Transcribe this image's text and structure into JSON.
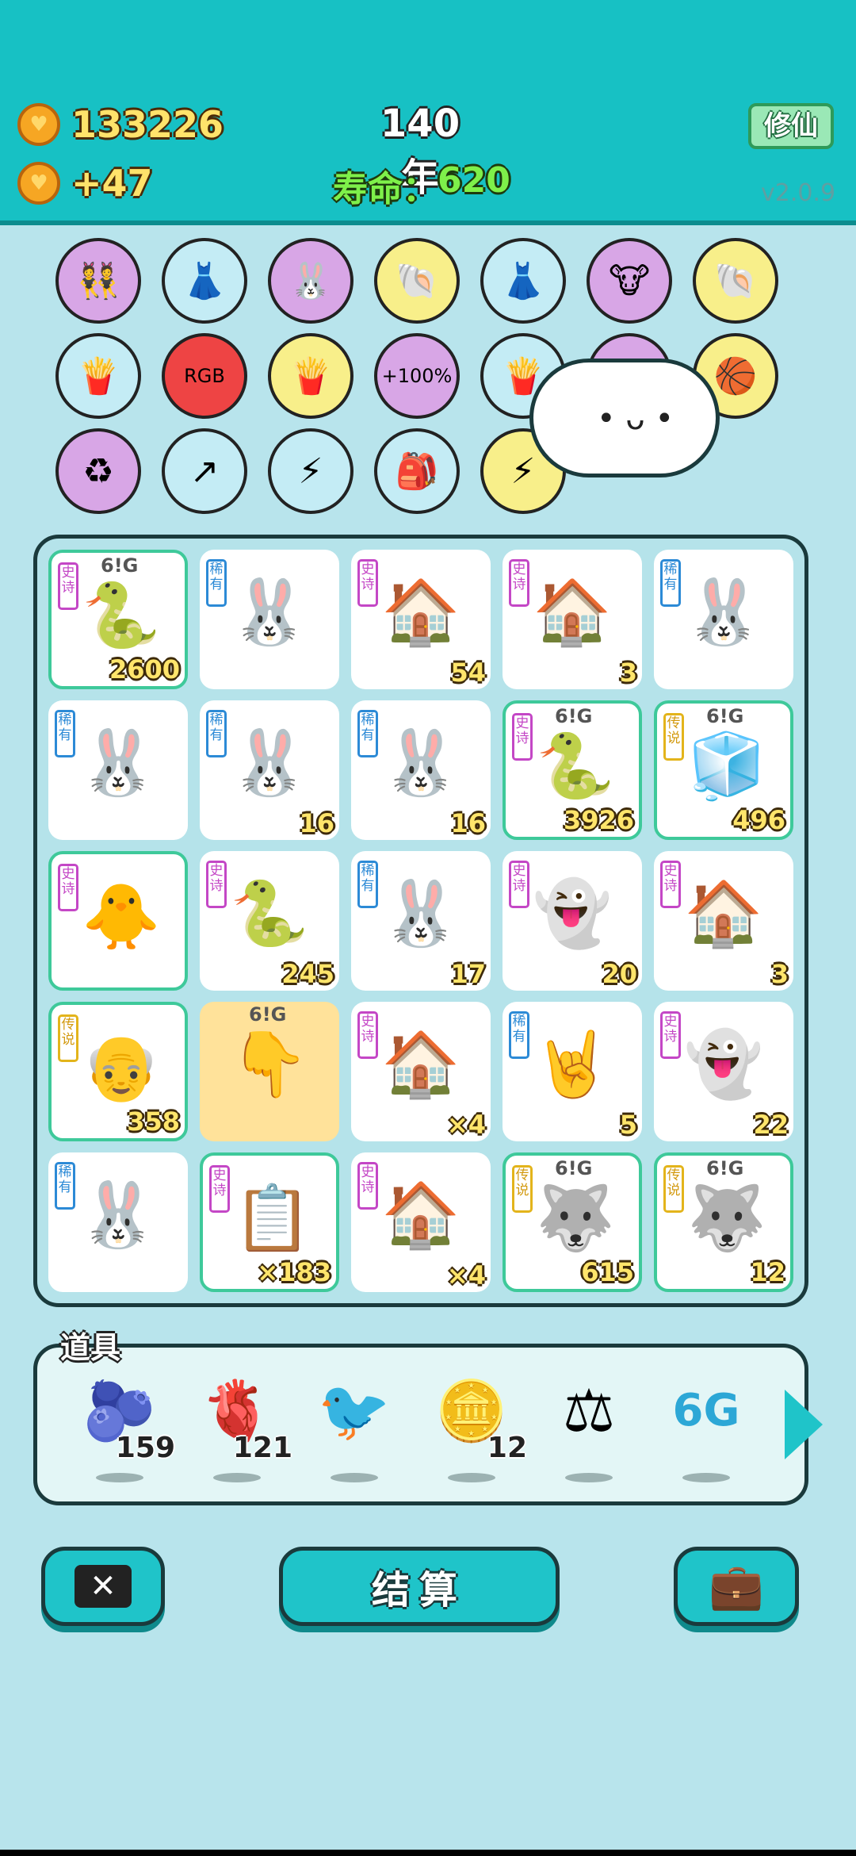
{
  "header": {
    "coins": "133226",
    "income": "+47",
    "year": "140年",
    "lifespan_label": "寿命：",
    "lifespan_value": "620",
    "xiuxian_button": "修仙",
    "version": "v2.0.9"
  },
  "upgrade_icons": [
    {
      "name": "twins",
      "glyph": "👯",
      "bg": "#d8a6e6"
    },
    {
      "name": "skirt",
      "glyph": "👗",
      "bg": "#c4ecf5"
    },
    {
      "name": "rabbit",
      "glyph": "🐰",
      "bg": "#d8a6e6"
    },
    {
      "name": "shell",
      "glyph": "🐚",
      "bg": "#f8ef8a"
    },
    {
      "name": "skirt",
      "glyph": "👗",
      "bg": "#c4ecf5"
    },
    {
      "name": "cow-card",
      "glyph": "🐮",
      "bg": "#d8a6e6"
    },
    {
      "name": "shell",
      "glyph": "🐚",
      "bg": "#f8ef8a"
    },
    {
      "name": "fries",
      "glyph": "🍟",
      "bg": "#c4ecf5"
    },
    {
      "name": "rgb",
      "glyph": "RGB",
      "bg": "#e44"
    },
    {
      "name": "fries",
      "glyph": "🍟",
      "bg": "#f8ef8a"
    },
    {
      "name": "bucket",
      "glyph": "+100%",
      "bg": "#d8a6e6"
    },
    {
      "name": "fries",
      "glyph": "🍟",
      "bg": "#c4ecf5"
    },
    {
      "name": "hidden",
      "glyph": "",
      "bg": "#d8a6e6"
    },
    {
      "name": "basketballs",
      "glyph": "🏀",
      "bg": "#f8ef8a"
    },
    {
      "name": "recycle",
      "glyph": "♻",
      "bg": "#d8a6e6"
    },
    {
      "name": "arrow-box",
      "glyph": "↗",
      "bg": "#c4ecf5"
    },
    {
      "name": "lightning-plant",
      "glyph": "⚡",
      "bg": "#c4ecf5"
    },
    {
      "name": "sack",
      "glyph": "🎒",
      "bg": "#c4ecf5"
    },
    {
      "name": "lightning",
      "glyph": "⚡",
      "bg": "#f8ef8a"
    }
  ],
  "tag_labels": {
    "epic": "史诗",
    "rare": "稀有",
    "legend": "传说"
  },
  "badge_6g": "6!G",
  "board": [
    [
      {
        "tag": "epic",
        "glyph": "🐍",
        "num": "2600",
        "legend": true,
        "badge": true
      },
      {
        "tag": "rare",
        "glyph": "🐰",
        "num": ""
      },
      {
        "tag": "epic",
        "glyph": "🏠",
        "num": "54"
      },
      {
        "tag": "epic",
        "glyph": "🏠",
        "num": "3"
      },
      {
        "tag": "rare",
        "glyph": "🐰",
        "num": ""
      }
    ],
    [
      {
        "tag": "rare",
        "glyph": "🐰",
        "num": ""
      },
      {
        "tag": "rare",
        "glyph": "🐰",
        "num": "16"
      },
      {
        "tag": "rare",
        "glyph": "🐰",
        "num": "16"
      },
      {
        "tag": "epic",
        "glyph": "🐍",
        "num": "3926",
        "legend": true,
        "badge": true
      },
      {
        "tag": "legend",
        "glyph": "🧊",
        "num": "496",
        "legend": true,
        "badge": true
      }
    ],
    [
      {
        "tag": "epic",
        "glyph": "🐥",
        "num": "",
        "legend": true
      },
      {
        "tag": "epic",
        "glyph": "🐍",
        "num": "245"
      },
      {
        "tag": "rare",
        "glyph": "🐰",
        "num": "17"
      },
      {
        "tag": "epic",
        "glyph": "👻",
        "num": "20"
      },
      {
        "tag": "epic",
        "glyph": "🏠",
        "num": "3"
      }
    ],
    [
      {
        "tag": "legend",
        "glyph": "👴",
        "num": "358",
        "legend": true
      },
      {
        "tag": "",
        "glyph": "👇",
        "num": "",
        "gold": true,
        "badge": true
      },
      {
        "tag": "epic",
        "glyph": "🏠",
        "num": "×4"
      },
      {
        "tag": "rare",
        "glyph": "🤘",
        "num": "5"
      },
      {
        "tag": "epic",
        "glyph": "👻",
        "num": "22"
      }
    ],
    [
      {
        "tag": "rare",
        "glyph": "🐰",
        "num": ""
      },
      {
        "tag": "epic",
        "glyph": "📋",
        "num": "×183",
        "legend": true
      },
      {
        "tag": "epic",
        "glyph": "🏠",
        "num": "×4"
      },
      {
        "tag": "legend",
        "glyph": "🐺",
        "num": "615",
        "legend": true,
        "badge": true
      },
      {
        "tag": "legend",
        "glyph": "🐺",
        "num": "12",
        "legend": true,
        "badge": true
      }
    ]
  ],
  "tools_title": "道具",
  "tools": [
    {
      "name": "blueberry",
      "glyph": "🫐",
      "count": "159"
    },
    {
      "name": "liver",
      "glyph": "🫀",
      "count": "121"
    },
    {
      "name": "bird",
      "glyph": "🐦",
      "count": ""
    },
    {
      "name": "coin",
      "glyph": "🪙",
      "count": "12"
    },
    {
      "name": "frame",
      "glyph": "⚖",
      "count": ""
    },
    {
      "name": "6g",
      "glyph": "6G",
      "count": ""
    }
  ],
  "buttons": {
    "close_glyph": "✕",
    "settle": "结算",
    "bag_glyph": "💼"
  }
}
